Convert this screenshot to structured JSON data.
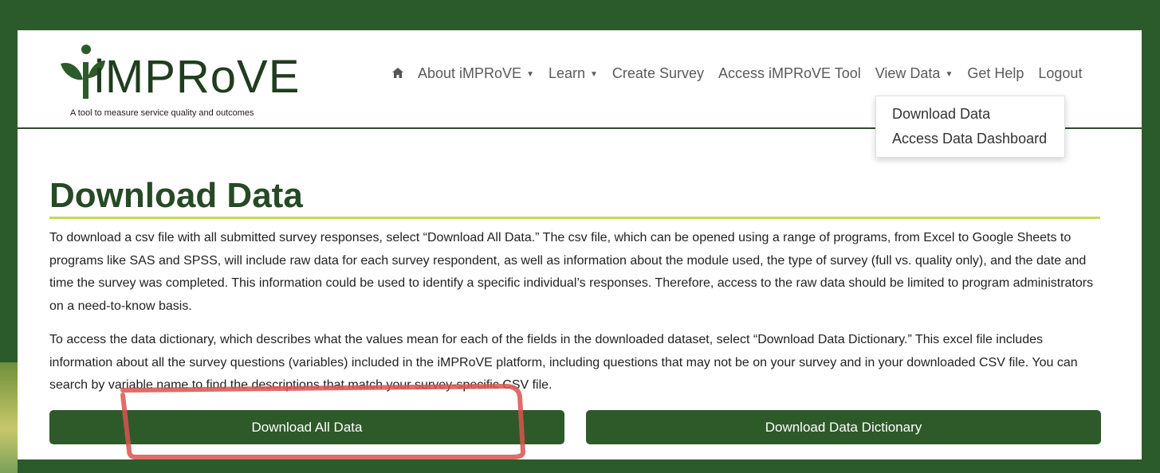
{
  "logo": {
    "wordmark": "iMPRoVE",
    "tagline": "A tool to measure service quality and outcomes"
  },
  "nav": {
    "home_icon": "home-icon",
    "items": [
      {
        "label": "About iMPRoVE",
        "has_dropdown": true
      },
      {
        "label": "Learn",
        "has_dropdown": true
      },
      {
        "label": "Create Survey",
        "has_dropdown": false
      },
      {
        "label": "Access iMPRoVE Tool",
        "has_dropdown": false
      },
      {
        "label": "View Data",
        "has_dropdown": true
      },
      {
        "label": "Get Help",
        "has_dropdown": false
      },
      {
        "label": "Logout",
        "has_dropdown": false
      }
    ],
    "dropdown": {
      "items": [
        "Download Data",
        "Access Data Dashboard"
      ]
    }
  },
  "page": {
    "title": "Download Data",
    "paragraph1": "To download a csv file with all submitted survey responses, select “Download All Data.” The csv file, which can be opened using a range of programs, from Excel to Google Sheets to programs like SAS and SPSS, will include raw data for each survey respondent, as well as information about the module used, the type of survey (full vs. quality only), and the date and time the survey was completed. This information could be used to identify a specific individual’s responses. Therefore, access to the raw data should be limited to program administrators on a need-to-know basis.",
    "paragraph2": "To access the data dictionary, which describes what the values mean for each of the fields in the downloaded dataset, select “Download Data Dictionary.” This excel file includes information about all the survey questions (variables) included in the iMPRoVE platform, including questions that may not be on your survey and in your downloaded CSV file. You can search by variable name to find the descriptions that match your survey-specific CSV file."
  },
  "buttons": {
    "download_all": "Download All Data",
    "download_dictionary": "Download Data Dictionary"
  },
  "colors": {
    "frame": "#2c5b2b",
    "button": "#2e5a2a",
    "title": "#264a25",
    "rule": "#c9d65a",
    "annotation": "#d9534f"
  }
}
